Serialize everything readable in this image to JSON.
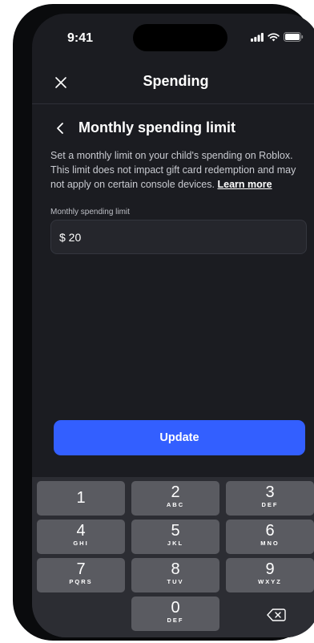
{
  "status_bar": {
    "time": "9:41"
  },
  "nav": {
    "title": "Spending"
  },
  "section": {
    "title": "Monthly spending limit",
    "description": "Set a monthly limit on your child's spending on Roblox. This limit does not impact gift card redemption and may not apply on certain console devices.",
    "learn_more": "Learn more"
  },
  "field": {
    "label": "Monthly spending limit",
    "value": "$ 20"
  },
  "update_button": {
    "label": "Update"
  },
  "keypad": {
    "keys": [
      {
        "num": "1",
        "letters": ""
      },
      {
        "num": "2",
        "letters": "ABC"
      },
      {
        "num": "3",
        "letters": "DEF"
      },
      {
        "num": "4",
        "letters": "GHI"
      },
      {
        "num": "5",
        "letters": "JKL"
      },
      {
        "num": "6",
        "letters": "MNO"
      },
      {
        "num": "7",
        "letters": "PQRS"
      },
      {
        "num": "8",
        "letters": "TUV"
      },
      {
        "num": "9",
        "letters": "WXYZ"
      },
      {
        "num": "0",
        "letters": "DEF"
      }
    ]
  }
}
